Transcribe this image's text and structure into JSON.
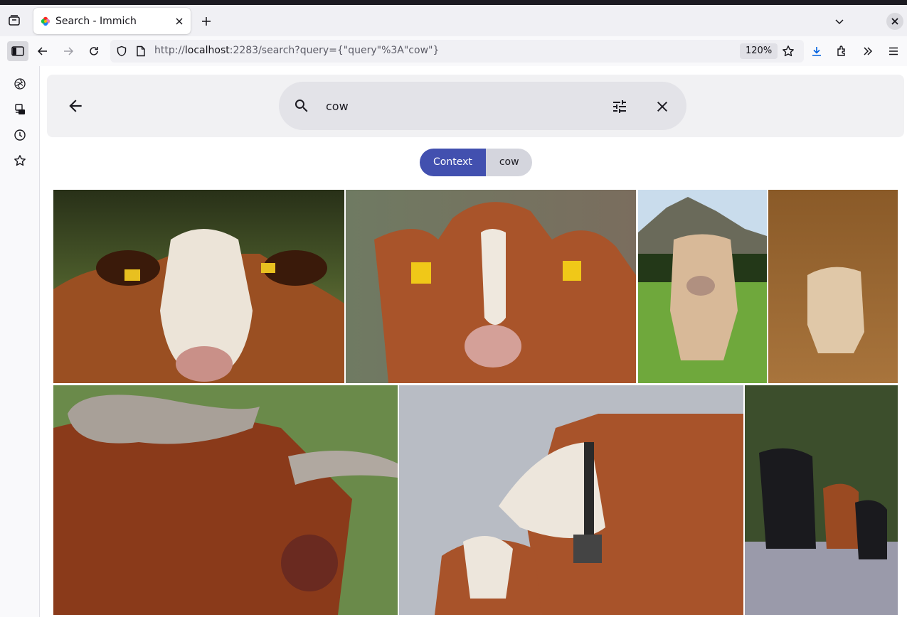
{
  "browser": {
    "tab_title": "Search - Immich",
    "url_scheme": "http://",
    "url_host": "localhost",
    "url_rest": ":2283/search?query={\"query\"%3A\"cow\"}",
    "zoom": "120%"
  },
  "search": {
    "query": "cow",
    "filter_key": "Context",
    "filter_value": "cow"
  },
  "gallery": {
    "photos": [
      {
        "subject": "brown and white cow with ear tags, close-up"
      },
      {
        "subject": "brown cow with white blaze and yellow ear tags"
      },
      {
        "subject": "light brown cow standing in alpine meadow"
      },
      {
        "subject": "pale cow walking on dusty ground, sepia tone"
      },
      {
        "subject": "highland cattle with long horns"
      },
      {
        "subject": "brown and white cow wearing a bell collar"
      },
      {
        "subject": "black and brown cattle with calves in a field"
      }
    ]
  },
  "colors": {
    "accent": "#4250af",
    "chip_value_bg": "#d4d5dd",
    "panel_bg": "#f1f1f3",
    "searchbox_bg": "#e3e3e8"
  }
}
